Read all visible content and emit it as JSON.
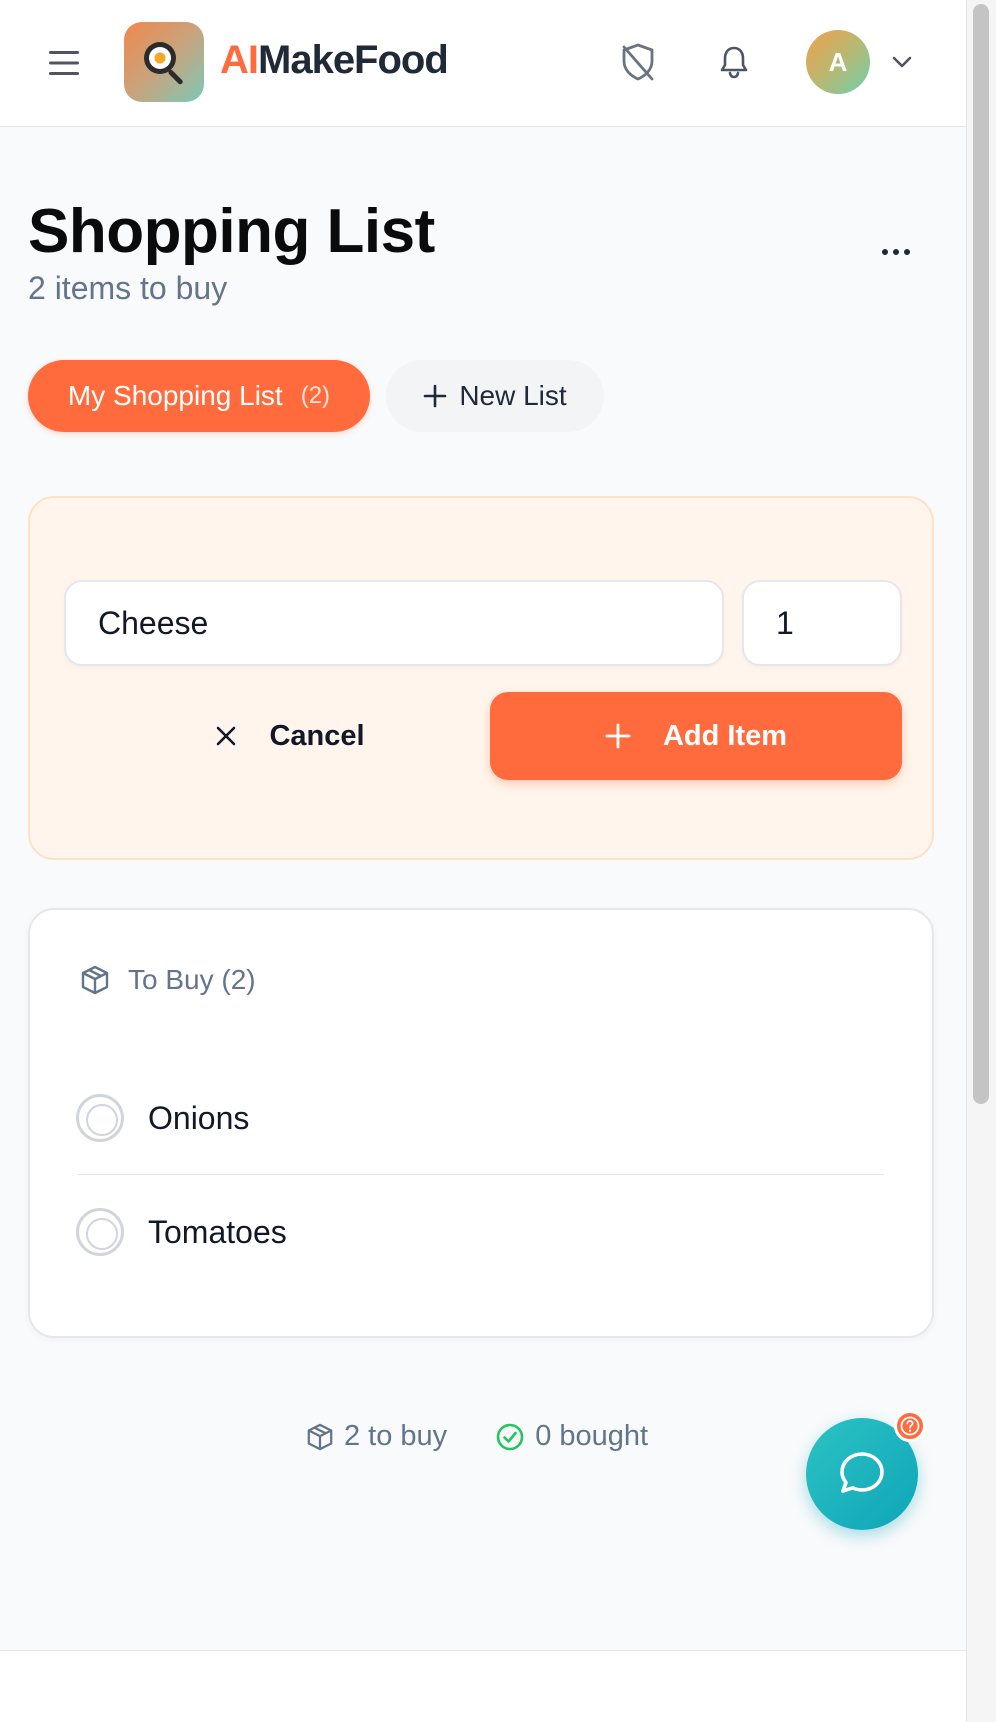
{
  "header": {
    "brand_ai": "AI",
    "brand_rest": "MakeFood",
    "avatar_initial": "A",
    "icons": [
      "menu-icon",
      "frying-pan-icon",
      "shield-off-icon",
      "bell-icon",
      "chevron-down-icon"
    ]
  },
  "page": {
    "title": "Shopping List",
    "subtitle": "2 items to buy",
    "more_icon": "more-horizontal-icon"
  },
  "tabs": {
    "active_label": "My Shopping List",
    "active_count": "(2)",
    "new_label": "New List"
  },
  "add_form": {
    "item_value": "Cheese",
    "qty_value": "1",
    "cancel_label": "Cancel",
    "add_label": "Add Item"
  },
  "list": {
    "section_title": "To Buy (2)",
    "items": [
      {
        "label": "Onions"
      },
      {
        "label": "Tomatoes"
      }
    ]
  },
  "stats": {
    "to_buy": "2 to buy",
    "bought": "0 bought"
  },
  "colors": {
    "accent": "#ff6b3d",
    "teal": "#0ea5b9",
    "success": "#22c55e",
    "muted": "#64748b"
  }
}
